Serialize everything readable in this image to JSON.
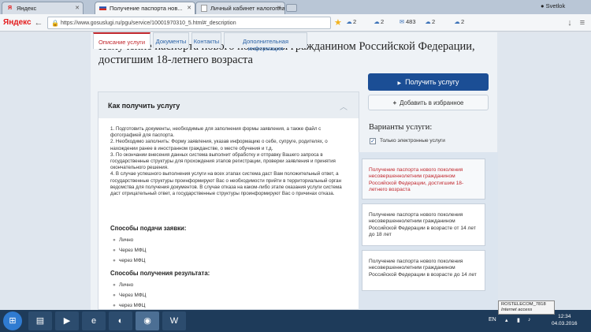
{
  "browser": {
    "tabs": [
      {
        "label": "Яндекс",
        "favicon": "Я"
      },
      {
        "label": "Получение паспорта нов...",
        "favicon": "flag"
      },
      {
        "label": "Личный кабинет налогопла...",
        "favicon": "doc"
      }
    ],
    "profile": "Svetlok",
    "url": "https://www.gosuslugi.ru/pgu/service/10001970310_5.html#_description",
    "brand": "Яндекс",
    "ext": {
      "weather1": "2",
      "weather2": "2",
      "mail": "483",
      "weather3": "2",
      "weather4": "2"
    }
  },
  "page": {
    "title": "Получение паспорта нового поколения гражданином Российской Федерации, достигшим 18-летнего возраста",
    "tabs": [
      "Описание услуги",
      "Документы",
      "Контакты",
      "Дополнительная информация"
    ],
    "section_title": "Как получить услугу",
    "steps": [
      "1. Подготовить документы, необходимые для заполнения формы заявления, а также файл с фотографией для паспорта.",
      "2. Необходимо заполнить: Форму заявления, указав информацию о себе, супруге, родителях, о нахождении ранее в иностранном гражданстве, о месте обучения и т.д.",
      "3. По окончании внесения данных система выполнит обработку и отправку Вашего запроса в государственные структуры для прохождения этапов регистрации, проверки заявления и принятия окончательного решения.",
      "4. В случае успешного выполнения услуги на всех этапах система даст Вам положительный ответ, а государственные структуры проинформируют Вас о необходимости прийти в территориальный орган ведомства для получения документов. В случае отказа на каком-либо этапе оказания услуги система даст отрицательный ответ, а государственные структуры проинформируют Вас о причинах отказа."
    ],
    "submit_title": "Способы подачи заявки:",
    "submit_methods": [
      "Лично",
      "Через МФЦ",
      "через МФЦ"
    ],
    "result_title": "Способы получения результата:",
    "result_methods": [
      "Лично",
      "Через МФЦ",
      "через МФЦ"
    ]
  },
  "sidebar": {
    "get_service": "Получить услугу",
    "add_favorite": "Добавить в избранное",
    "variants_title": "Варианты услуги:",
    "electronic_only": "Только электронные услуги",
    "electronic_only_checked": true,
    "variants": [
      "Получение паспорта нового поколения несовершеннолетним гражданином Российской Федерации, достигшим 18-летнего возраста",
      "Получение паспорта нового поколения несовершеннолетним гражданином Российской Федерации в возрасте от 14 лет до 18 лет",
      "Получение паспорта нового поколения несовершеннолетним гражданином Российской Федерации в возрасте до 14 лет"
    ]
  },
  "taskbar": {
    "lang": "EN",
    "tooltip_line1": "ROSTELECOM_7818",
    "tooltip_line2": "Internet access",
    "time": "12:34",
    "date": "04.03.2016"
  },
  "colors": {
    "primary": "#1b4e95",
    "accent_red": "#c1272d",
    "link": "#2a62a6"
  }
}
